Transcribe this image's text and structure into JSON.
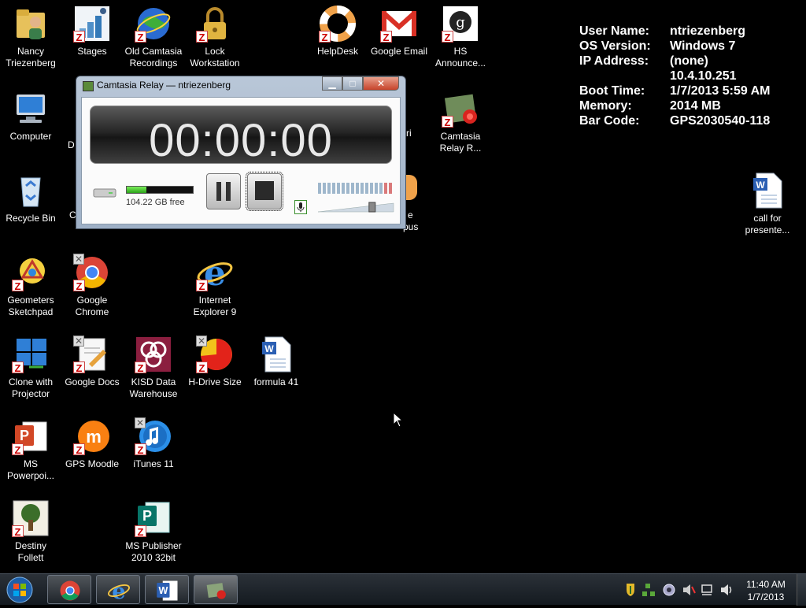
{
  "desktop": {
    "icons": [
      {
        "id": "nancy",
        "label": "Nancy\nTriezenberg"
      },
      {
        "id": "stages",
        "label": "Stages"
      },
      {
        "id": "oldcam",
        "label": "Old Camtasia\nRecordings"
      },
      {
        "id": "lock",
        "label": "Lock\nWorkstation"
      },
      {
        "id": "helpdesk",
        "label": "HelpDesk"
      },
      {
        "id": "gmail",
        "label": "Google Email"
      },
      {
        "id": "hs",
        "label": "HS\nAnnounce..."
      },
      {
        "id": "computer",
        "label": "Computer"
      },
      {
        "id": "relay",
        "label": "Camtasia\nRelay R..."
      },
      {
        "id": "recycle",
        "label": "Recycle Bin"
      },
      {
        "id": "callfor",
        "label": "call for\npresente..."
      },
      {
        "id": "geometers",
        "label": "Geometers\nSketchpad"
      },
      {
        "id": "chrome",
        "label": "Google\nChrome"
      },
      {
        "id": "ie9",
        "label": "Internet\nExplorer 9"
      },
      {
        "id": "clone",
        "label": "Clone with\nProjector"
      },
      {
        "id": "gdocs",
        "label": "Google Docs"
      },
      {
        "id": "kisd",
        "label": "KISD Data\nWarehouse"
      },
      {
        "id": "hdrive",
        "label": "H-Drive Size"
      },
      {
        "id": "formula",
        "label": "formula 41"
      },
      {
        "id": "msppt",
        "label": "MS\nPowerpoi..."
      },
      {
        "id": "moodle",
        "label": "GPS Moodle"
      },
      {
        "id": "itunes",
        "label": "iTunes 11"
      },
      {
        "id": "destiny",
        "label": "Destiny\nFollett"
      },
      {
        "id": "publisher",
        "label": "MS Publisher\n2010 32bit"
      }
    ],
    "partial_labels": {
      "d_behind": "D",
      "c_behind": "C",
      "ri_behind": "ri",
      "e_behind": "e",
      "pus_behind": "pus"
    }
  },
  "sysinfo": {
    "rows": [
      {
        "key": "User Name:",
        "value": "ntriezenberg"
      },
      {
        "key": "OS Version:",
        "value": "Windows 7"
      },
      {
        "key": "IP Address:",
        "value": "(none)"
      },
      {
        "key": "",
        "value": "10.4.10.251"
      },
      {
        "key": "Boot Time:",
        "value": "1/7/2013 5:59 AM"
      },
      {
        "key": "Memory:",
        "value": "2014 MB"
      },
      {
        "key": "Bar Code:",
        "value": "GPS2030540-118"
      }
    ]
  },
  "camtasia": {
    "title": "Camtasia Relay — ntriezenberg",
    "timer": "00:00:00",
    "free_space": "104.22 GB free",
    "disk_used_fraction": 0.3,
    "volume_level": 0.72
  },
  "taskbar": {
    "clock_time": "11:40 AM",
    "clock_date": "1/7/2013",
    "pinned": [
      "chrome-icon",
      "ie-icon",
      "word-icon",
      "camtasia-relay-icon"
    ]
  },
  "colors": {
    "accent": "#3a8f2d",
    "close": "#c7432b",
    "background": "#000000"
  }
}
